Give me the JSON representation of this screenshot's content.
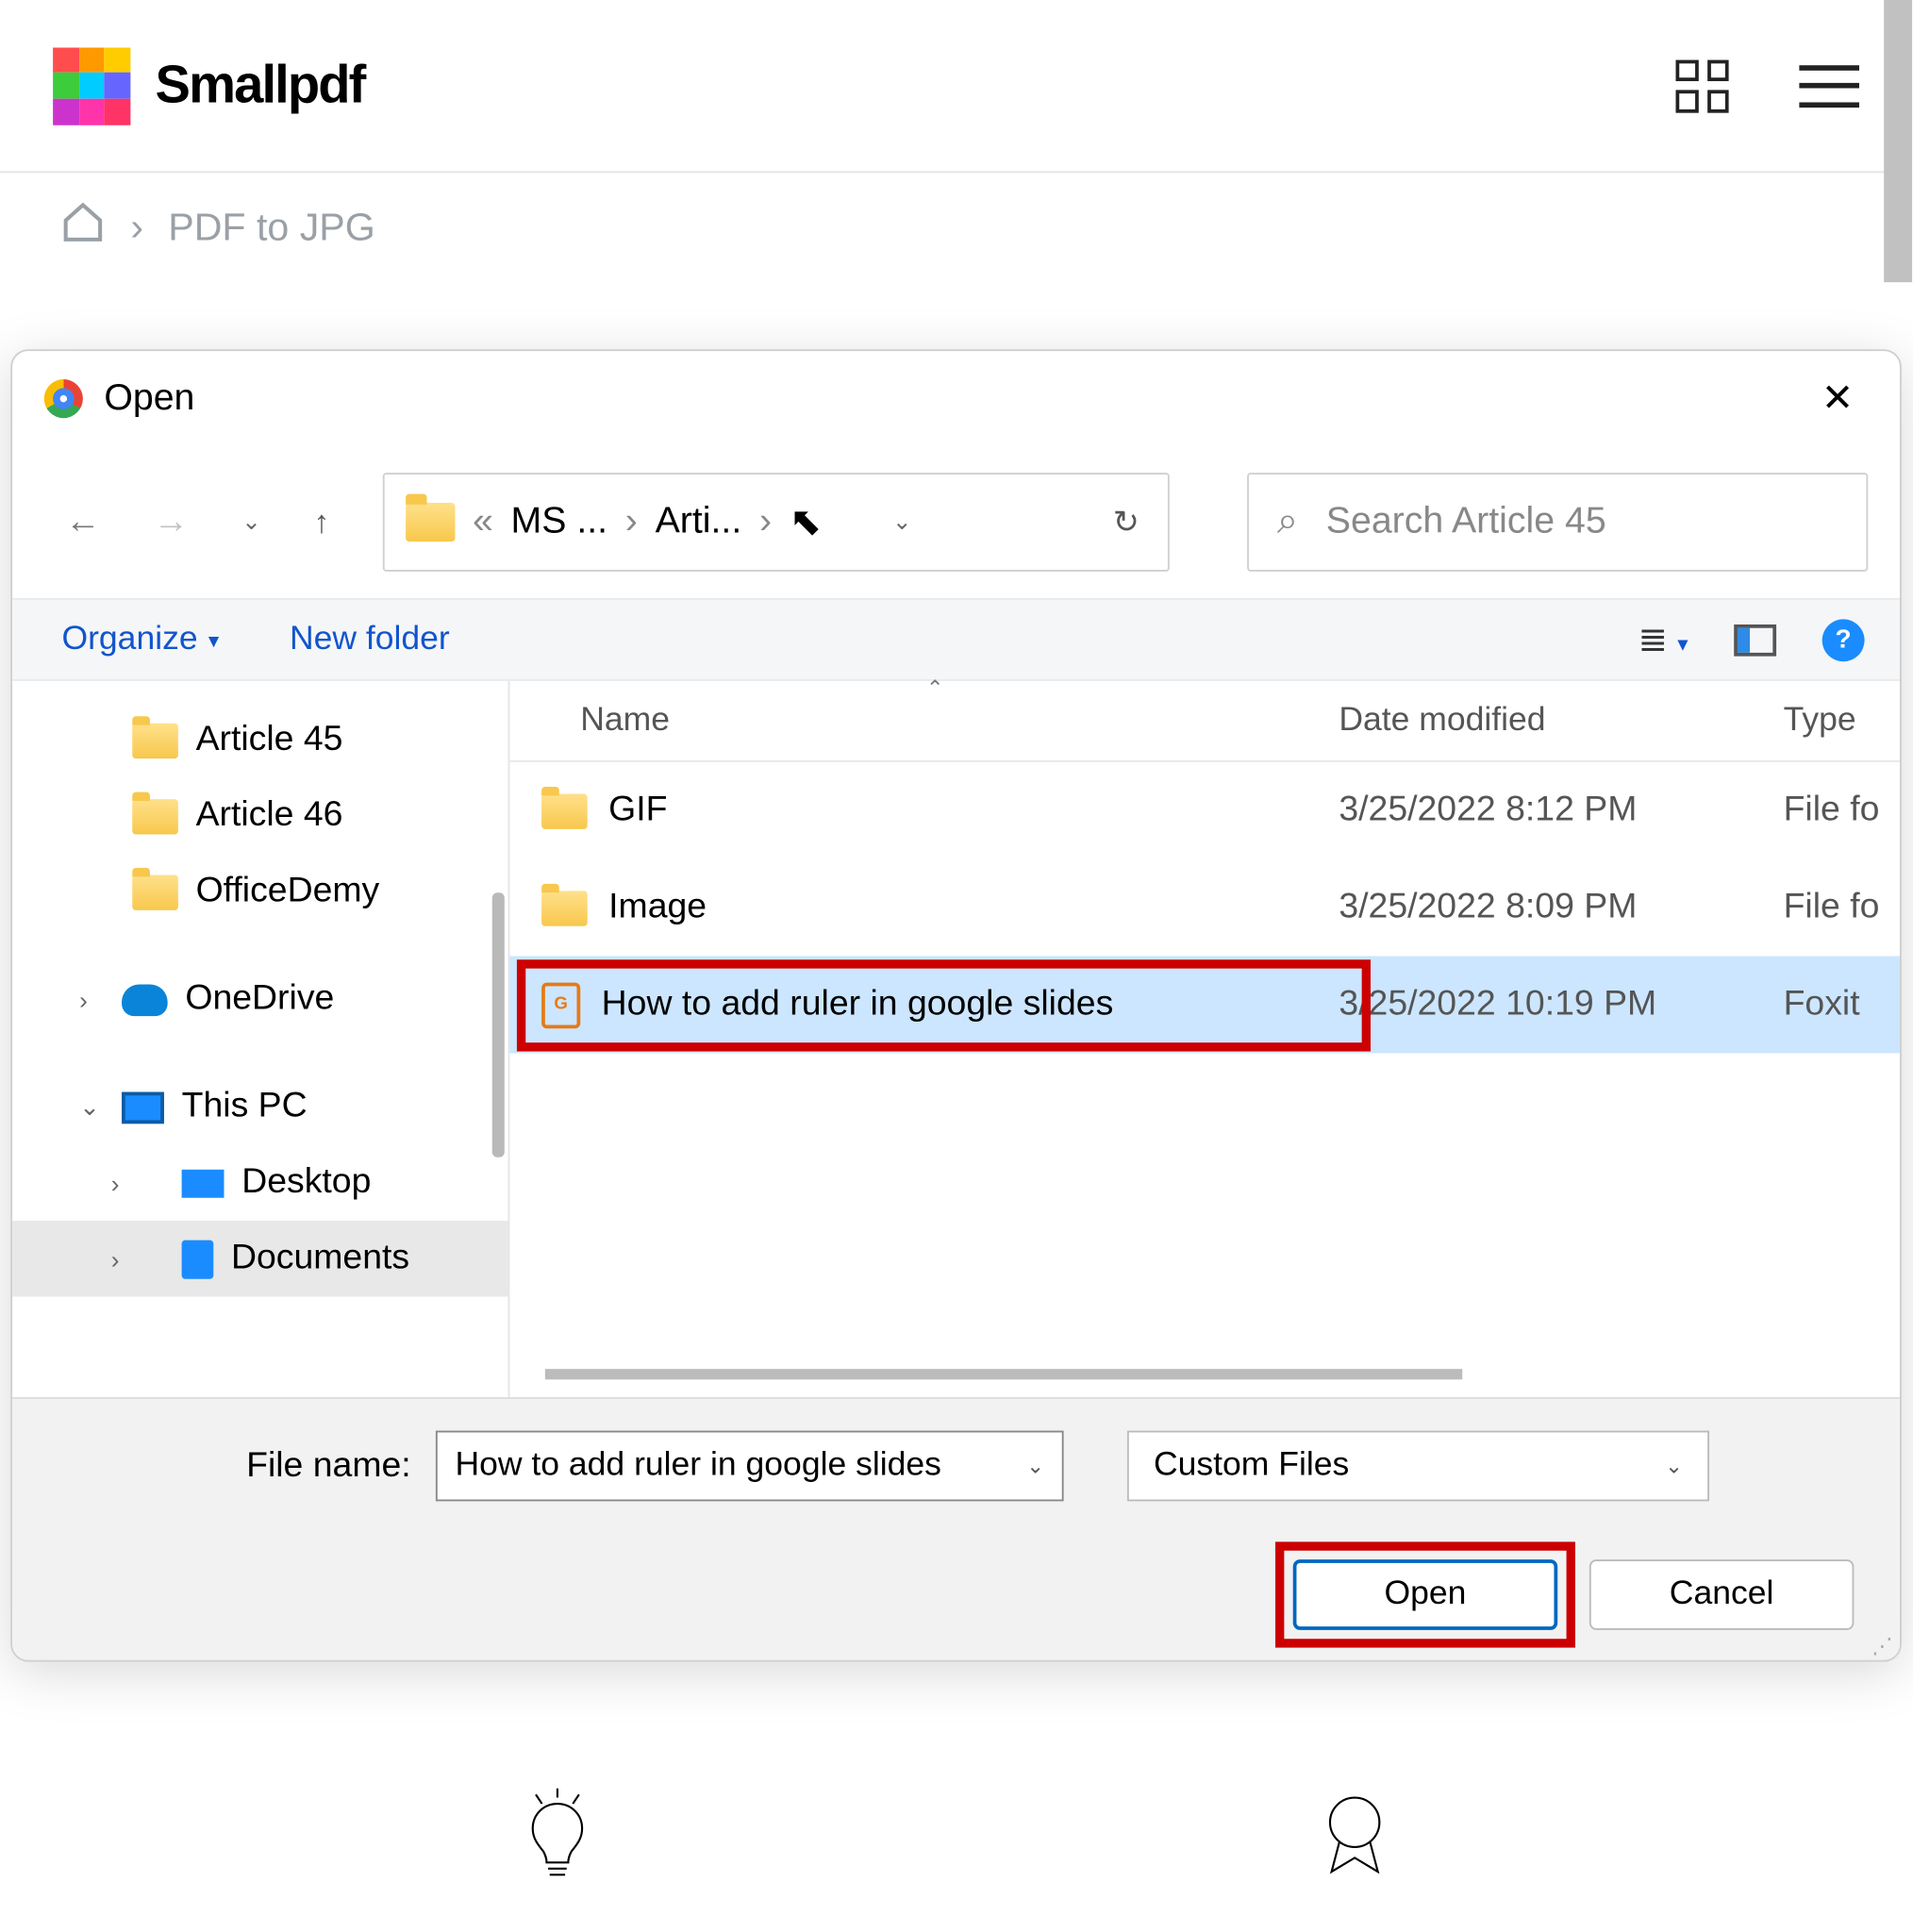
{
  "header": {
    "brand": "Smallpdf"
  },
  "breadcrumb": {
    "page": "PDF to JPG"
  },
  "dialog": {
    "title": "Open",
    "path": {
      "seg1_short": "MS ...",
      "seg2_short": "Arti..."
    },
    "search_placeholder": "Search Article 45",
    "toolbar": {
      "organize": "Organize",
      "new_folder": "New folder",
      "help": "?"
    },
    "tree": {
      "items": [
        {
          "label": "Article 45"
        },
        {
          "label": "Article 46"
        },
        {
          "label": "OfficeDemy"
        },
        {
          "label": "OneDrive"
        },
        {
          "label": "This PC"
        },
        {
          "label": "Desktop"
        },
        {
          "label": "Documents"
        }
      ]
    },
    "columns": {
      "name": "Name",
      "date": "Date modified",
      "type": "Type"
    },
    "files": [
      {
        "name": "GIF",
        "date": "3/25/2022 8:12 PM",
        "type": "File fo",
        "kind": "folder"
      },
      {
        "name": "Image",
        "date": "3/25/2022 8:09 PM",
        "type": "File fo",
        "kind": "folder"
      },
      {
        "name": "How to add ruler in google slides",
        "date": "3/25/2022 10:19 PM",
        "type": "Foxit",
        "kind": "pdf",
        "selected": true
      }
    ],
    "footer": {
      "file_name_label": "File name:",
      "file_name_value": "How to add ruler in google slides",
      "filter_label": "Custom Files",
      "open": "Open",
      "cancel": "Cancel"
    }
  }
}
